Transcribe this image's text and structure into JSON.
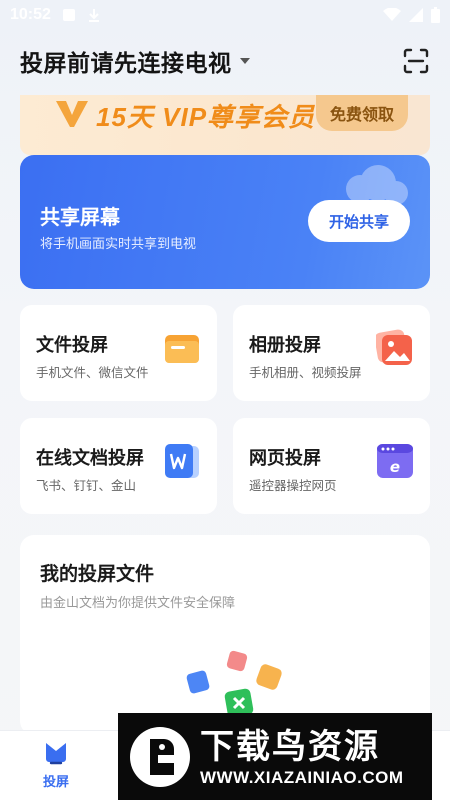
{
  "status_bar": {
    "time": "10:52"
  },
  "header": {
    "title": "投屏前请先连接电视",
    "scan_icon": "scan-icon"
  },
  "promo": {
    "text": "15天 VIP尊享会员",
    "button": "免费领取"
  },
  "share": {
    "title": "共享屏幕",
    "subtitle": "将手机画面实时共享到电视",
    "button": "开始共享"
  },
  "tiles": [
    {
      "title": "文件投屏",
      "subtitle": "手机文件、微信文件",
      "icon": "folder-icon"
    },
    {
      "title": "相册投屏",
      "subtitle": "手机相册、视频投屏",
      "icon": "photo-icon"
    },
    {
      "title": "在线文档投屏",
      "subtitle": "飞书、钉钉、金山",
      "icon": "word-doc-icon"
    },
    {
      "title": "网页投屏",
      "subtitle": "遥控器操控网页",
      "icon": "browser-icon"
    }
  ],
  "my_files": {
    "title": "我的投屏文件",
    "subtitle": "由金山文档为你提供文件安全保障"
  },
  "tabbar": {
    "items": [
      {
        "label": "投屏",
        "icon": "cast-icon",
        "active": true
      }
    ]
  },
  "watermark": {
    "name": "下载鸟资源",
    "url": "WWW.XIAZAINIAO.COM"
  },
  "colors": {
    "primary": "#3b6ff2",
    "promo_text": "#f08c1a",
    "tab_active": "#3a6ef0"
  }
}
